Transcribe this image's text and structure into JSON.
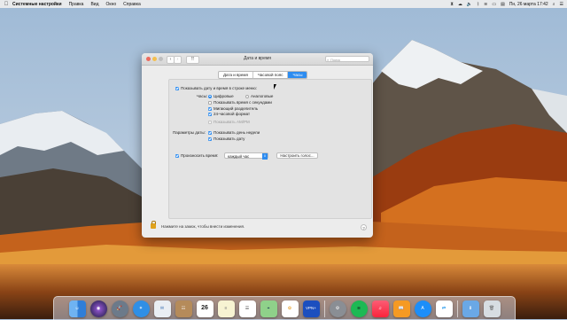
{
  "menubar": {
    "apple_icon": "apple-icon",
    "app_name": "Системные настройки",
    "menus": [
      "Правка",
      "Вид",
      "Окно",
      "Справка"
    ],
    "clock": "Пн, 26 марта 17:42",
    "right_icons": [
      "hourglass-icon",
      "cloud-icon",
      "speaker-icon",
      "bluetooth-icon",
      "wifi-icon",
      "battery-icon",
      "flag-icon",
      "search-icon",
      "list-icon"
    ]
  },
  "window": {
    "title": "Дата и время",
    "search_placeholder": "Поиск",
    "tabs": [
      "Дата и время",
      "Часовой пояс",
      "Часы"
    ],
    "active_tab": "Часы",
    "show_in_menu_label": "Показывать дату и время в строке меню:",
    "clock_label": "Часы:",
    "digital_label": "Цифровые",
    "analog_label": "Аналоговые",
    "show_seconds_label": "Показывать время с секундами",
    "blink_label": "Мигающий разделитель",
    "use24_label": "24-часовой формат",
    "ampm_label": "Показывать AM/PM",
    "date_params_label": "Параметры даты:",
    "weekday_label": "Показывать день недели",
    "show_date_label": "Показывать дату",
    "announce_label": "Произносить время:",
    "interval_value": "каждый час",
    "customize_voice_label": "Настроить голос...",
    "lock_text": "Нажмите на замок, чтобы внести изменения.",
    "help_label": "?"
  },
  "dock": {
    "calendar_day": "26",
    "vpn_label": "VPN+",
    "items": [
      "finder-icon",
      "siri-icon",
      "launchpad-icon",
      "safari-icon",
      "mail-icon",
      "contacts-icon",
      "calendar-icon",
      "notes-icon",
      "reminders-icon",
      "maps-icon",
      "photos-icon",
      "vpn-icon",
      "system-preferences-icon",
      "spotify-icon",
      "music-icon",
      "books-icon",
      "app-store-icon",
      "teamviewer-icon",
      "downloads-folder-icon",
      "trash-icon"
    ]
  }
}
